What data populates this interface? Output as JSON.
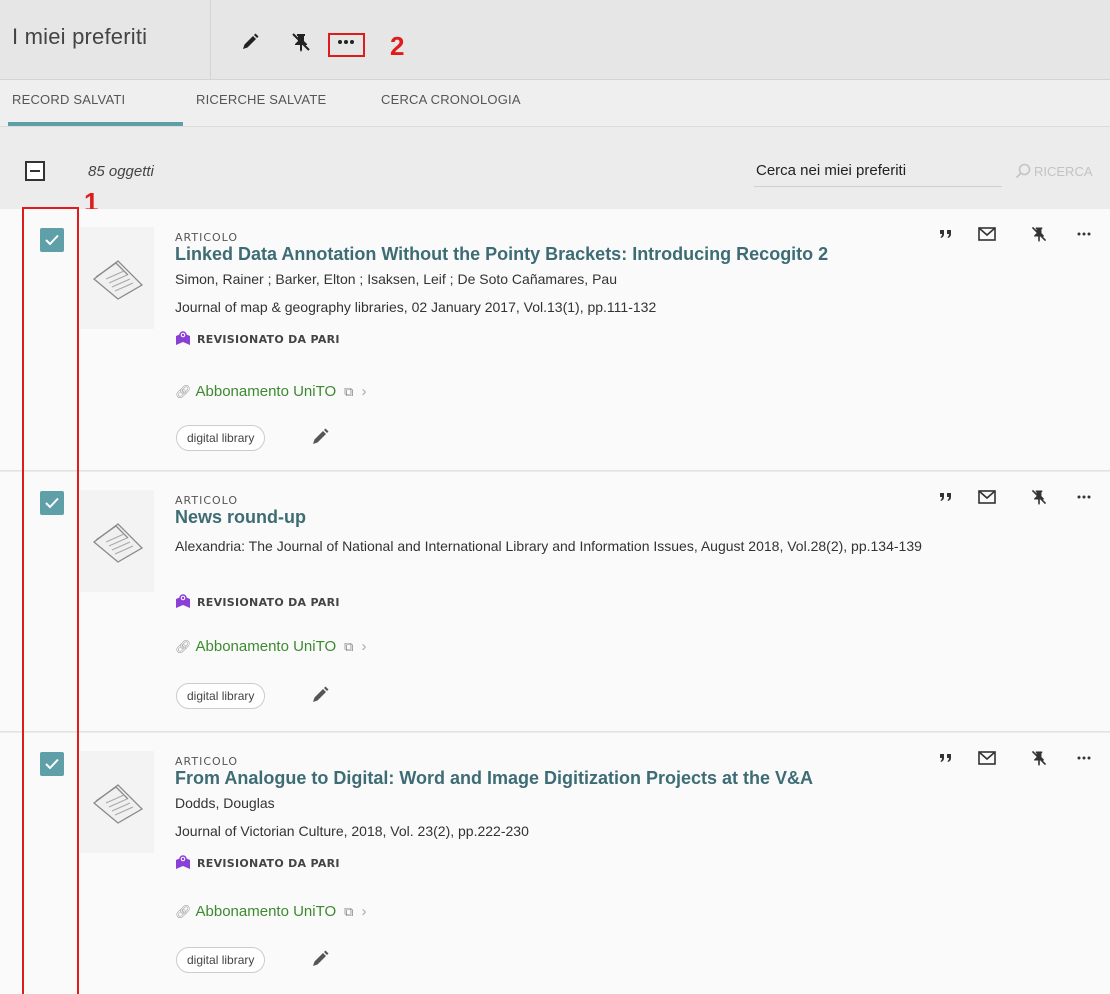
{
  "header": {
    "title": "I miei preferiti",
    "annotation_label": "2"
  },
  "tabs": [
    {
      "label": "RECORD SALVATI",
      "active": true
    },
    {
      "label": "RICERCHE SALVATE",
      "active": false
    },
    {
      "label": "CERCA CRONOLOGIA",
      "active": false
    }
  ],
  "toolbar": {
    "count": "85 oggetti",
    "search_value": "Cerca nei miei preferiti",
    "search_button": "RICERCA",
    "annotation_label": "1"
  },
  "records": [
    {
      "type": "ARTICOLO",
      "title": "Linked Data Annotation Without the Pointy Brackets: Introducing Recogito 2",
      "authors": "Simon, Rainer ; Barker, Elton ; Isaksen, Leif ; De Soto Cañamares, Pau",
      "source": "Journal of map & geography libraries, 02 January 2017, Vol.13(1), pp.111-132",
      "peer": "REVISIONATO DA PARI",
      "link": "Abbonamento UniTO",
      "tag": "digital library",
      "checked": true
    },
    {
      "type": "ARTICOLO",
      "title": "News round-up",
      "authors": "",
      "source": "Alexandria: The Journal of National and International Library and Information Issues, August 2018, Vol.28(2), pp.134-139",
      "peer": "REVISIONATO DA PARI",
      "link": "Abbonamento UniTO",
      "tag": "digital library",
      "checked": true
    },
    {
      "type": "ARTICOLO",
      "title": "From Analogue to Digital: Word and Image Digitization Projects at the V&A",
      "authors": "Dodds, Douglas",
      "source": "Journal of Victorian Culture, 2018, Vol. 23(2), pp.222-230",
      "peer": "REVISIONATO DA PARI",
      "link": "Abbonamento UniTO",
      "tag": "digital library",
      "checked": true
    }
  ],
  "colors": {
    "accent": "#5e9fa8",
    "title": "#3d6c75",
    "link": "#3c8a2f",
    "annotation": "#e01b1b"
  }
}
